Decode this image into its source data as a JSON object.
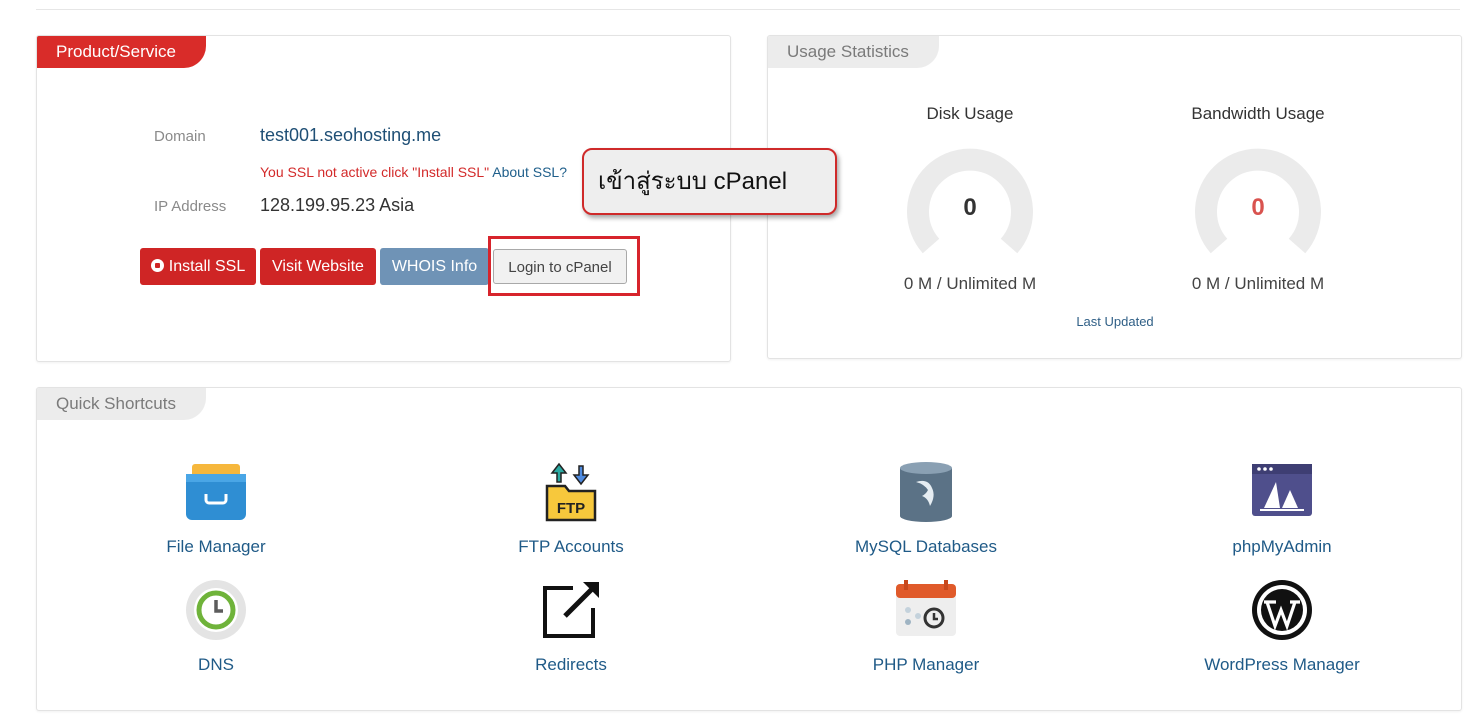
{
  "product": {
    "tab_title": "Product/Service",
    "domain_label": "Domain",
    "domain_value": "test001.seohosting.me",
    "ssl_note": "You SSL not active click \"Install SSL\"",
    "about_ssl": "About SSL?",
    "ip_label": "IP Address",
    "ip_value": "128.199.95.23 Asia",
    "buttons": {
      "install_ssl": "Install SSL",
      "visit_website": "Visit Website",
      "whois": "WHOIS Info",
      "login_cpanel": "Login to cPanel"
    }
  },
  "callout": {
    "text": "เข้าสู่ระบบ cPanel"
  },
  "usage": {
    "tab_title": "Usage Statistics",
    "disk": {
      "title": "Disk Usage",
      "value": "0",
      "amount": "0 M / Unlimited M"
    },
    "bandwidth": {
      "title": "Bandwidth Usage",
      "value": "0",
      "amount": "0 M / Unlimited M"
    },
    "last_updated": "Last Updated"
  },
  "shortcuts": {
    "tab_title": "Quick Shortcuts",
    "items": [
      {
        "label": "File Manager",
        "icon": "file-manager-icon"
      },
      {
        "label": "FTP Accounts",
        "icon": "ftp-icon"
      },
      {
        "label": "MySQL Databases",
        "icon": "mysql-icon"
      },
      {
        "label": "phpMyAdmin",
        "icon": "phpmyadmin-icon"
      },
      {
        "label": "DNS",
        "icon": "dns-icon"
      },
      {
        "label": "Redirects",
        "icon": "redirect-icon"
      },
      {
        "label": "PHP Manager",
        "icon": "php-manager-icon"
      },
      {
        "label": "WordPress Manager",
        "icon": "wordpress-icon"
      }
    ]
  },
  "colors": {
    "brand_red": "#d92c29",
    "link_blue": "#1f5a87",
    "gauge_track": "#ebebeb",
    "bandwidth_value": "#d9534f"
  }
}
